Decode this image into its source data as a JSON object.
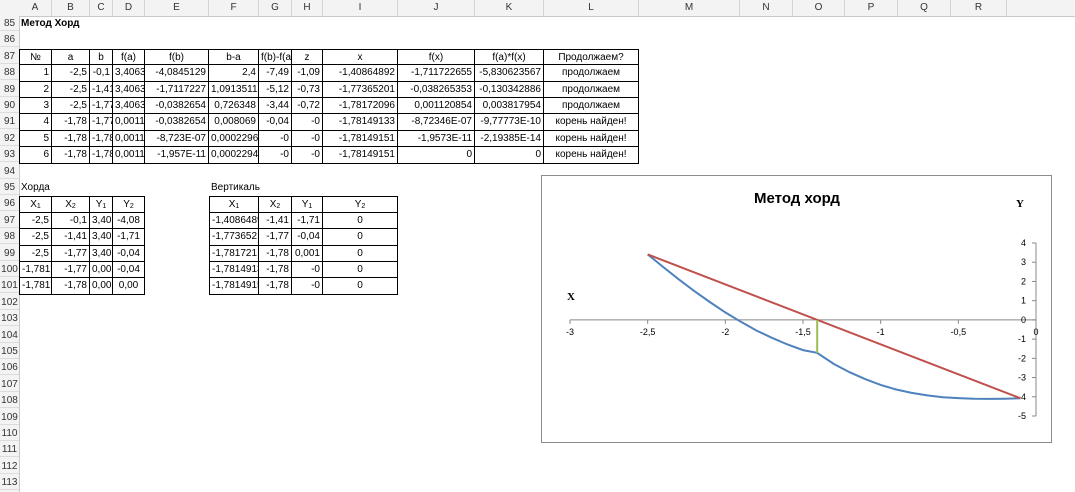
{
  "columns": [
    "A",
    "B",
    "C",
    "D",
    "E",
    "F",
    "G",
    "H",
    "I",
    "J",
    "K",
    "L",
    "M",
    "N",
    "O",
    "P",
    "Q",
    "R"
  ],
  "rows": [
    "85",
    "86",
    "87",
    "88",
    "89",
    "90",
    "91",
    "92",
    "93",
    "94",
    "95",
    "96",
    "97",
    "98",
    "99",
    "100",
    "101",
    "102",
    "103",
    "104",
    "105",
    "106",
    "107",
    "108",
    "109",
    "110",
    "111",
    "112",
    "113"
  ],
  "title": "Метод Хорд",
  "main_table": {
    "headers": [
      "№",
      "a",
      "b",
      "f(a)",
      "f(b)",
      "b-a",
      "f(b)-f(a",
      "z",
      "x",
      "f(x)",
      "f(a)*f(x)",
      "Продолжаем?"
    ],
    "rows": [
      [
        "1",
        "-2,5",
        "-0,1",
        "3,4063",
        "-4,0845129",
        "2,4",
        "-7,49",
        "-1,09",
        "-1,40864892",
        "-1,711722655",
        "-5,830623567",
        "продолжаем"
      ],
      [
        "2",
        "-2,5",
        "-1,41",
        "3,4063",
        "-1,7117227",
        "1,0913511",
        "-5,12",
        "-0,73",
        "-1,77365201",
        "-0,038265353",
        "-0,130342886",
        "продолжаем"
      ],
      [
        "3",
        "-2,5",
        "-1,77",
        "3,4063",
        "-0,0382654",
        "0,726348",
        "-3,44",
        "-0,72",
        "-1,78172096",
        "0,001120854",
        "0,003817954",
        "продолжаем"
      ],
      [
        "4",
        "-1,78",
        "-1,77",
        "0,0011",
        "-0,0382654",
        "0,008069",
        "-0,04",
        "-0",
        "-1,78149133",
        "-8,72346E-07",
        "-9,77773E-10",
        "корень найден!"
      ],
      [
        "5",
        "-1,78",
        "-1,78",
        "0,0011",
        "-8,723E-07",
        "0,0002296",
        "-0",
        "-0",
        "-1,78149151",
        "-1,9573E-11",
        "-2,19385E-14",
        "корень найден!"
      ],
      [
        "6",
        "-1,78",
        "-1,78",
        "0,0011",
        "-1,957E-11",
        "0,0002294",
        "-0",
        "-0",
        "-1,78149151",
        "0",
        "0",
        "корень найден!"
      ]
    ]
  },
  "chord_table": {
    "title": "Хорда",
    "headers": [
      [
        "X",
        "1"
      ],
      [
        "X",
        "2"
      ],
      [
        "Y",
        "1"
      ],
      [
        "Y",
        "2"
      ]
    ],
    "rows": [
      [
        "-2,5",
        "-0,1",
        "3,406",
        "-4,08"
      ],
      [
        "-2,5",
        "-1,41",
        "3,406",
        "-1,71"
      ],
      [
        "-2,5",
        "-1,77",
        "3,406",
        "-0,04"
      ],
      [
        "-1,78172",
        "-1,77",
        "0,001",
        "-0,04"
      ],
      [
        "-1,78172",
        "-1,78",
        "0,001",
        "0,00"
      ]
    ]
  },
  "vertical_table": {
    "title": "Вертикаль",
    "headers": [
      [
        "X",
        "1"
      ],
      [
        "X",
        "2"
      ],
      [
        "Y",
        "1"
      ],
      [
        "Y",
        "2"
      ]
    ],
    "rows": [
      [
        "-1,4086489",
        "-1,41",
        "-1,71",
        "0"
      ],
      [
        "-1,773652",
        "-1,77",
        "-0,04",
        "0"
      ],
      [
        "-1,781721",
        "-1,78",
        "0,001",
        "0"
      ],
      [
        "-1,7814913",
        "-1,78",
        "-0",
        "0"
      ],
      [
        "-1,7814915",
        "-1,78",
        "-0",
        "0"
      ]
    ]
  },
  "chart_data": {
    "type": "line",
    "title": "Метод хорд",
    "xlabel": "X",
    "ylabel": "Y",
    "xlim": [
      -3,
      0
    ],
    "ylim": [
      -5,
      4
    ],
    "x_ticks": [
      "-3",
      "-2,5",
      "-2",
      "-1,5",
      "-1",
      "-0,5",
      "0"
    ],
    "y_ticks": [
      "4",
      "3",
      "2",
      "1",
      "0",
      "-1",
      "-2",
      "-3",
      "-4",
      "-5"
    ],
    "grid": false,
    "series": [
      {
        "color": "#4f81bd",
        "x": [
          -2.5,
          -2.4,
          -2.3,
          -2.2,
          -2.1,
          -2.0,
          -1.9,
          -1.8,
          -1.7,
          -1.6,
          -1.5,
          -1.41,
          -1.3,
          -1.2,
          -1.1,
          -1.0,
          -0.9,
          -0.8,
          -0.7,
          -0.6,
          -0.5,
          -0.4,
          -0.3,
          -0.2,
          -0.1
        ],
        "y": [
          3.406,
          2.75,
          2.11,
          1.5,
          0.93,
          0.39,
          -0.1,
          -0.55,
          -0.93,
          -1.28,
          -1.57,
          -1.71,
          -2.3,
          -2.72,
          -3.08,
          -3.38,
          -3.62,
          -3.8,
          -3.93,
          -4.02,
          -4.07,
          -4.1,
          -4.11,
          -4.1,
          -4.08
        ]
      },
      {
        "color": "#c0504d",
        "x": [
          -2.5,
          -0.1
        ],
        "y": [
          3.406,
          -4.08
        ]
      },
      {
        "color": "#9bbb59",
        "x": [
          -1.4086,
          -1.4086
        ],
        "y": [
          -1.71,
          0
        ]
      }
    ]
  }
}
